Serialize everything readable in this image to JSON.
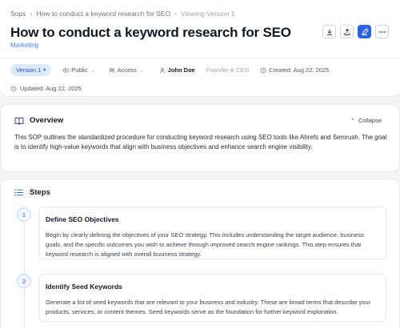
{
  "breadcrumb": {
    "root": "Sops",
    "page": "How to conduct a keyword research for SEO",
    "version_note": "Viewing Version 1"
  },
  "header": {
    "title": "How to conduct a keyword research for SEO",
    "category": "Marketing"
  },
  "actions": {
    "icons": [
      "download-icon",
      "share-icon",
      "edit-icon",
      "more-icon"
    ],
    "accent": "#2563eb"
  },
  "meta": {
    "version": "Version 1",
    "visibility": "Public",
    "access": "Access",
    "author": "John Doe",
    "author_role": "Founder & CEO",
    "created": "Created: Aug 22, 2025",
    "updated": "Updated: Aug 22, 2025"
  },
  "overview": {
    "heading": "Overview",
    "collapse_label": "Collapse",
    "text": "This SOP outlines the standardized procedure for conducting keyword research using SEO tools like Ahrefs and Semrush. The goal is to identify high-value keywords that align with business objectives and enhance search engine visibility."
  },
  "steps": {
    "heading": "Steps",
    "items": [
      {
        "number": "1",
        "title": "Define SEO Objectives",
        "description": "Begin by clearly defining the objectives of your SEO strategy. This includes understanding the target audience, business goals, and the specific outcomes you wish to achieve through improved search engine rankings. This step ensures that keyword research is aligned with overall business strategy."
      },
      {
        "number": "2",
        "title": "Identify Seed Keywords",
        "description": "Generate a list of seed keywords that are relevant to your business and industry. These are broad terms that describe your products, services, or content themes. Seed keywords serve as the foundation for further keyword exploration."
      }
    ]
  }
}
